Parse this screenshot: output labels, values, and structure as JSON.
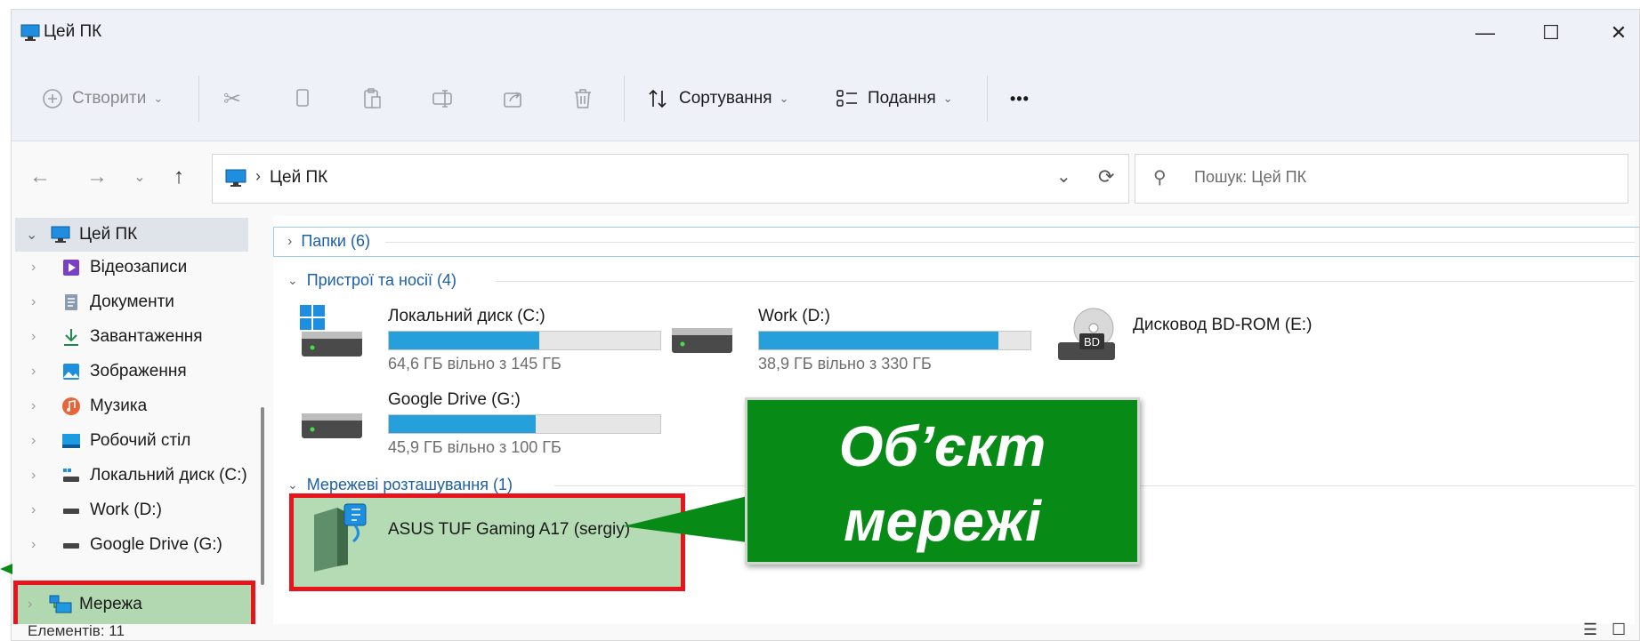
{
  "window": {
    "title": "Цей ПК",
    "controls": {
      "minimize": "—",
      "maximize": "☐",
      "close": "✕"
    }
  },
  "toolbar": {
    "new_label": "Створити",
    "sort_label": "Сортування",
    "view_label": "Подання",
    "more_label": "•••"
  },
  "address": {
    "path": "Цей ПК",
    "search_placeholder": "Пошук: Цей ПК"
  },
  "sidebar": {
    "root": "Цей ПК",
    "items": [
      {
        "label": "Відеозаписи",
        "icon": "videos-icon"
      },
      {
        "label": "Документи",
        "icon": "documents-icon"
      },
      {
        "label": "Завантаження",
        "icon": "downloads-icon"
      },
      {
        "label": "Зображення",
        "icon": "pictures-icon"
      },
      {
        "label": "Музика",
        "icon": "music-icon"
      },
      {
        "label": "Робочий стіл",
        "icon": "desktop-icon"
      },
      {
        "label": "Локальний диск (C:)",
        "icon": "drive-icon"
      },
      {
        "label": "Work (D:)",
        "icon": "drive-icon"
      },
      {
        "label": "Google Drive (G:)",
        "icon": "drive-icon"
      }
    ],
    "network": "Мережа"
  },
  "content": {
    "folders_header": "Папки (6)",
    "devices_header": "Пристрої та носії (4)",
    "network_header": "Мережеві розташування (1)",
    "drives": [
      {
        "name": "Локальний диск (C:)",
        "free": "64,6 ГБ вільно з 145 ГБ",
        "used_fraction": 0.555
      },
      {
        "name": "Work (D:)",
        "free": "38,9 ГБ вільно з 330 ГБ",
        "used_fraction": 0.882
      },
      {
        "name": "Google Drive (G:)",
        "free": "45,9 ГБ вільно з 100 ГБ",
        "used_fraction": 0.541
      }
    ],
    "bd_drive": "Дисковод BD-ROM (E:)",
    "network_item": "ASUS TUF Gaming A17 (sergiy)"
  },
  "status": {
    "count": "Елементів: 11"
  },
  "callout": {
    "line1": "Об’єкт",
    "line2": "мережі"
  },
  "colors": {
    "accent": "#26a0da",
    "highlight": "#e8131b",
    "callout": "#078a16"
  }
}
